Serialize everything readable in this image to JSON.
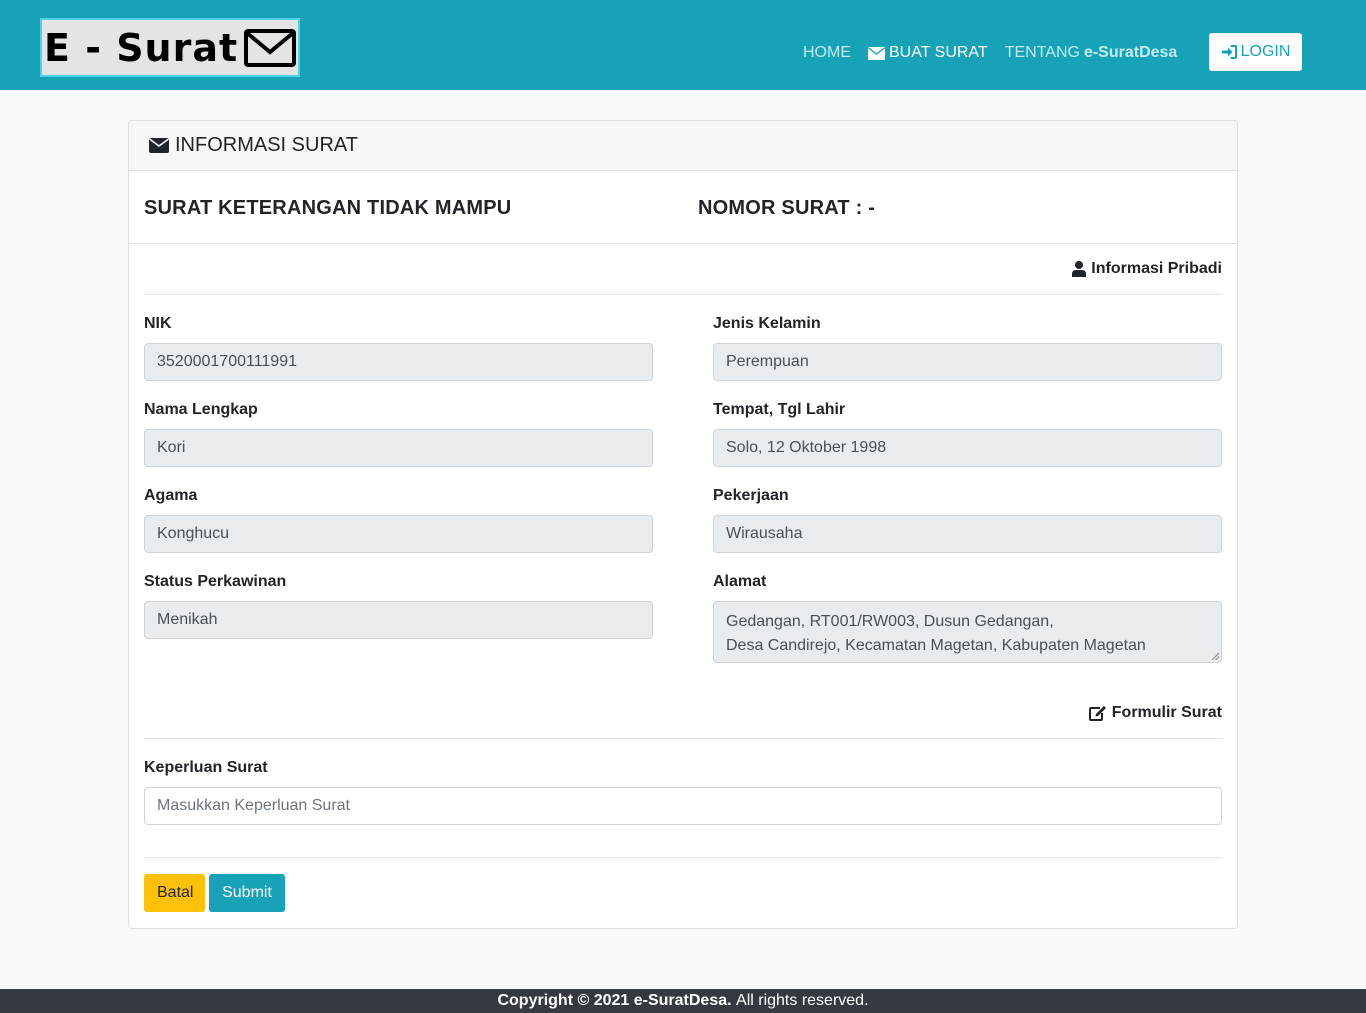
{
  "header": {
    "logo_text": "E - Surat",
    "nav": {
      "home": "HOME",
      "buat_surat": "BUAT SURAT",
      "tentang_prefix": "TENTANG",
      "tentang_brand": "e-SuratDesa"
    },
    "login_label": "LOGIN"
  },
  "card": {
    "header_title": "INFORMASI SURAT",
    "letter_type": "SURAT KETERANGAN TIDAK MAMPU",
    "letter_number": "NOMOR SURAT : -",
    "section_personal": "Informasi Pribadi",
    "section_form": "Formulir Surat"
  },
  "fields": {
    "nik": {
      "label": "NIK",
      "value": "3520001700111991"
    },
    "jenis_kelamin": {
      "label": "Jenis Kelamin",
      "value": "Perempuan"
    },
    "nama_lengkap": {
      "label": "Nama Lengkap",
      "value": "Kori"
    },
    "ttl": {
      "label": "Tempat, Tgl Lahir",
      "value": "Solo, 12 Oktober 1998"
    },
    "agama": {
      "label": "Agama",
      "value": "Konghucu"
    },
    "pekerjaan": {
      "label": "Pekerjaan",
      "value": "Wirausaha"
    },
    "status_perkawinan": {
      "label": "Status Perkawinan",
      "value": "Menikah"
    },
    "alamat": {
      "label": "Alamat",
      "line1": "Gedangan, RT001/RW003, Dusun Gedangan,",
      "line2": "Desa Candirejo, Kecamatan Magetan, Kabupaten Magetan"
    }
  },
  "form": {
    "keperluan_label": "Keperluan Surat",
    "keperluan_placeholder": "Masukkan Keperluan Surat",
    "batal_label": "Batal",
    "submit_label": "Submit"
  },
  "footer": {
    "copyright_bold": "Copyright © 2021 e-SuratDesa.",
    "rights": "All rights reserved."
  },
  "colors": {
    "primary": "#17a2b8",
    "warning": "#ffc107",
    "footer_bg": "#343a40"
  }
}
